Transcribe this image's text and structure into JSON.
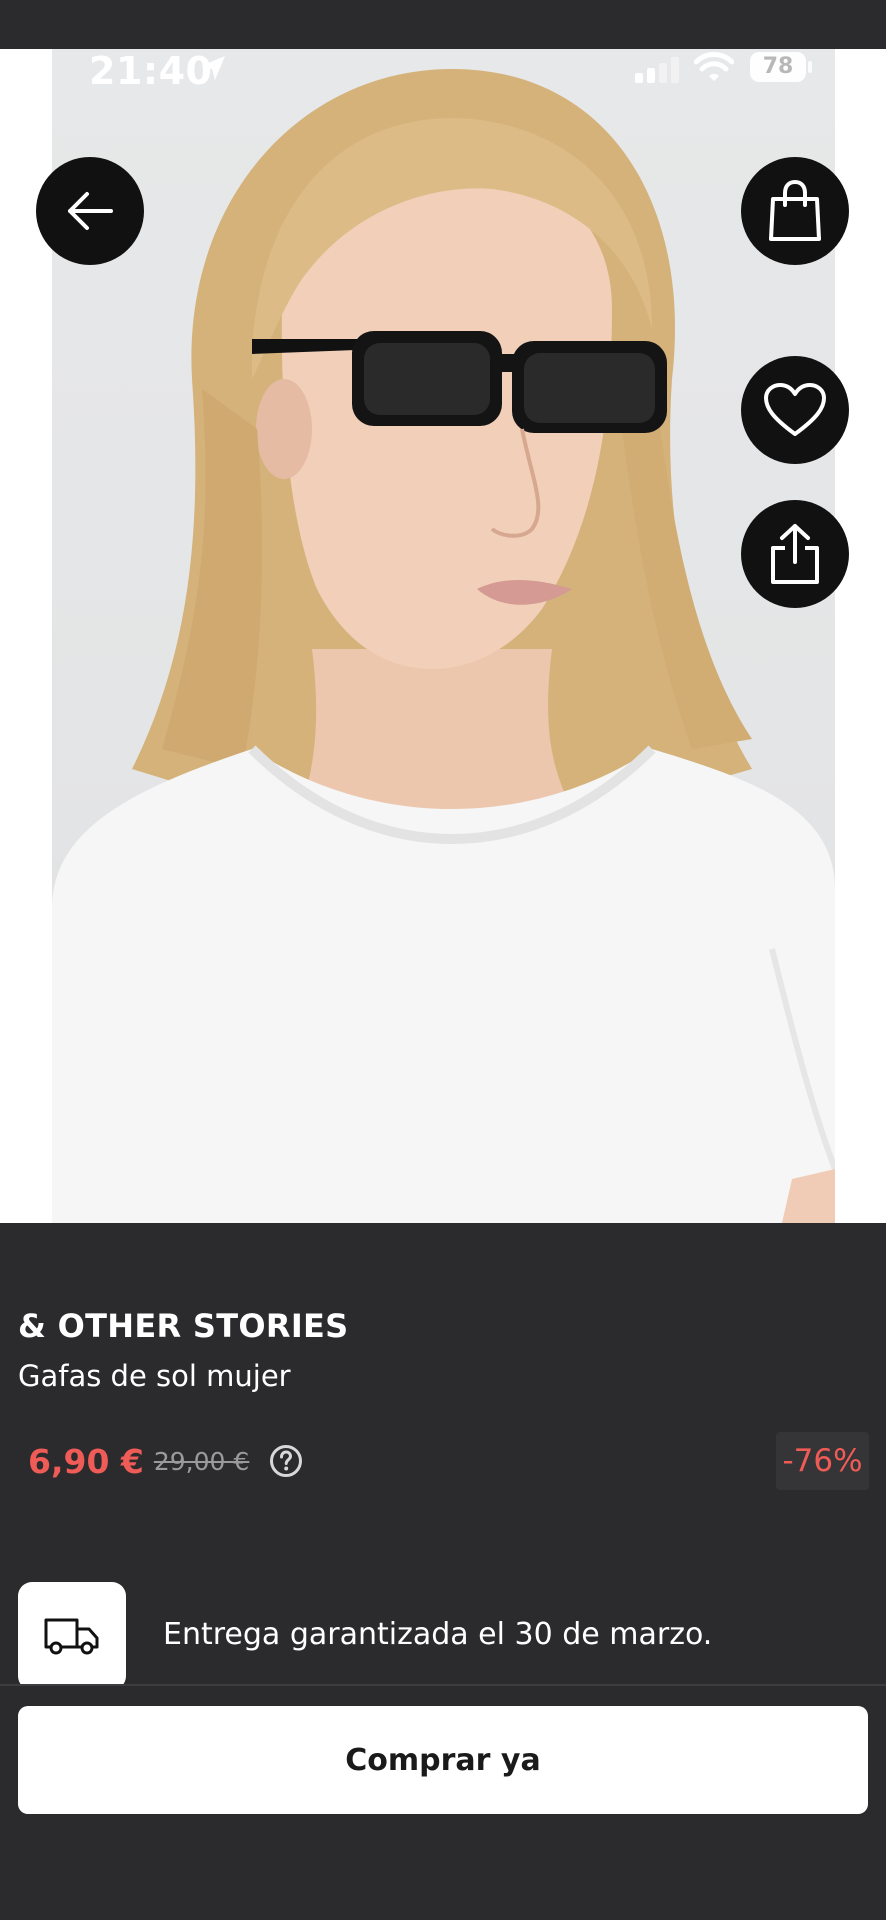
{
  "status_bar": {
    "time": "21:40",
    "battery": "78"
  },
  "product": {
    "brand": "& OTHER STORIES",
    "name": "Gafas de sol mujer",
    "price": "6,90 €",
    "original_price": "29,00 €",
    "discount": "-76%",
    "image_description_icon": "product-photo"
  },
  "delivery": {
    "text": "Entrega garantizada el 30 de marzo.",
    "icon": "truck-icon"
  },
  "actions": {
    "buy_label": "Comprar ya",
    "back_icon": "arrow-left-icon",
    "bag_icon": "shopping-bag-icon",
    "favorite_icon": "heart-icon",
    "share_icon": "share-icon"
  },
  "colors": {
    "background": "#2b2a2c",
    "price_red": "#ef5b56",
    "button_bg": "#ffffff",
    "circle_button": "#111111"
  }
}
